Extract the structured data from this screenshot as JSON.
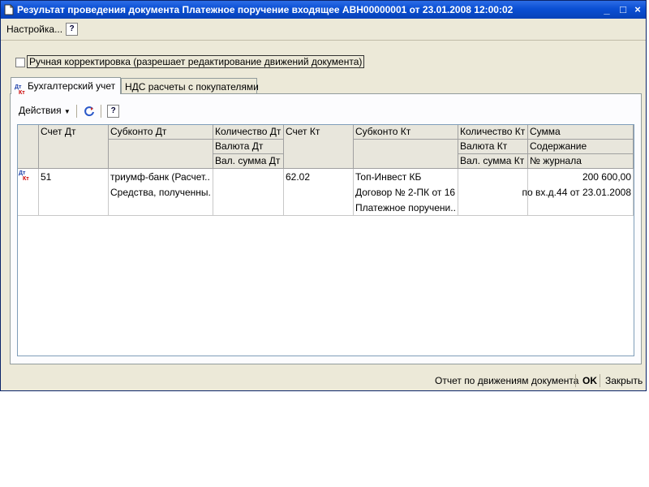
{
  "window": {
    "title": "Результат проведения документа Платежное поручение входящее АВН00000001 от 23.01.2008 12:00:02",
    "minimize": "_",
    "maximize": "□",
    "close": "×"
  },
  "menu": {
    "settings": "Настройка...",
    "help": "?"
  },
  "manual_edit": {
    "label": "Ручная корректировка (разрешает редактирование движений документа)",
    "checked": false
  },
  "tabs": [
    {
      "label": "Бухгалтерский учет",
      "active": true
    },
    {
      "label": "НДС расчеты с покупателями",
      "active": false
    }
  ],
  "tab_icon": {
    "top": "Дт",
    "bottom": "Кт"
  },
  "toolbar": {
    "actions": "Действия",
    "help": "?"
  },
  "grid": {
    "headers": {
      "dt_account": "Счет Дт",
      "dt_subconto": "Субконто Дт",
      "dt_qty": "Количество Дт",
      "dt_currency": "Валюта Дт",
      "dt_cur_amount": "Вал. сумма Дт",
      "kt_account": "Счет Кт",
      "kt_subconto": "Субконто Кт",
      "kt_qty": "Количество Кт",
      "kt_currency": "Валюта Кт",
      "kt_cur_amount": "Вал. сумма Кт",
      "amount": "Сумма",
      "content": "Содержание",
      "journal": "№ журнала"
    },
    "rows": [
      {
        "dt_account": "51",
        "dt_subconto": [
          "триумф-банк (Расчет...",
          "Средства, полученны..."
        ],
        "kt_account": "62.02",
        "kt_subconto": [
          "Топ-Инвест КБ",
          "Договор № 2-ПК от 16....",
          "Платежное поручени..."
        ],
        "amount": "200 600,00",
        "content": "по вх.д.44 от 23.01.2008"
      }
    ]
  },
  "statusbar": {
    "report": "Отчет по движениям документа",
    "ok": "OK",
    "close": "Закрыть"
  }
}
